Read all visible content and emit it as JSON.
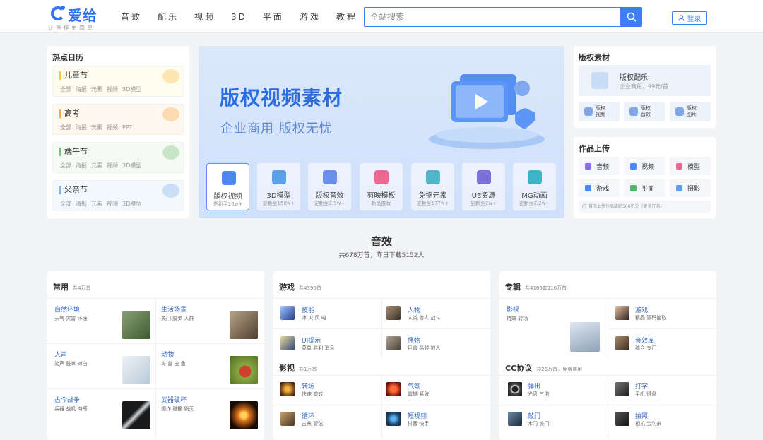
{
  "header": {
    "logo_text": "爱给",
    "slogan": "让创作更简单",
    "nav": [
      "音效",
      "配乐",
      "视频",
      "3D",
      "平面",
      "游戏",
      "教程"
    ],
    "search_placeholder": "全站搜索",
    "login_label": "登录"
  },
  "hot_calendar": {
    "title": "热点日历",
    "items": [
      {
        "name": "儿童节",
        "tags": [
          "全部",
          "海报",
          "元素",
          "视频",
          "3D模型"
        ],
        "deco_color": "#f5c242"
      },
      {
        "name": "高考",
        "tags": [
          "全部",
          "海报",
          "元素",
          "视频",
          "PPT"
        ],
        "deco_color": "#f5a742"
      },
      {
        "name": "端午节",
        "tags": [
          "全部",
          "海报",
          "元素",
          "视频",
          "3D模型"
        ],
        "deco_color": "#6fbf73"
      },
      {
        "name": "父亲节",
        "tags": [
          "全部",
          "海报",
          "元素",
          "视频",
          "3D模型"
        ],
        "deco_color": "#7fb2e8"
      }
    ]
  },
  "banner": {
    "title": "版权视频素材",
    "subtitle": "企业商用 版权无忧",
    "categories": [
      {
        "label": "版权视频",
        "sub": "更新至26w+",
        "color": "#4c86ef"
      },
      {
        "label": "3D模型",
        "sub": "更新至150w+",
        "color": "#5aa0ef"
      },
      {
        "label": "版权音效",
        "sub": "更新至2.9w+",
        "color": "#6a8ff0"
      },
      {
        "label": "剪映模板",
        "sub": "新品推荐",
        "color": "#e86a8f"
      },
      {
        "label": "免抠元素",
        "sub": "更新至177w+",
        "color": "#4fb7c9"
      },
      {
        "label": "UE资源",
        "sub": "更新至2w+",
        "color": "#7a6fe0"
      },
      {
        "label": "MG动画",
        "sub": "更新至2.2w+",
        "color": "#3fb3c7"
      }
    ]
  },
  "copyright_material": {
    "title": "版权素材",
    "main": {
      "name": "版权配乐",
      "sub": "企业商用，99元/首"
    },
    "items": [
      "版权视频",
      "版权音效",
      "版权图片"
    ]
  },
  "upload": {
    "title": "作品上传",
    "items": [
      {
        "label": "音频",
        "color": "#8a6ee8"
      },
      {
        "label": "视频",
        "color": "#4c86ef"
      },
      {
        "label": "模型",
        "color": "#e86a8f"
      },
      {
        "label": "游戏",
        "color": "#4c86ef"
      },
      {
        "label": "平面",
        "color": "#4fb76a"
      },
      {
        "label": "摄影",
        "color": "#5a9ff0"
      }
    ],
    "note": "首次上传作品奖励500积分（更多任务）"
  },
  "section": {
    "title": "音效",
    "subtitle": "共678万首，昨日下载5152人"
  },
  "common": {
    "title": "常用",
    "count": "共4万首",
    "cells": [
      {
        "name": "自然环境",
        "tags": "天气 灾害 环境",
        "thumb": "#5d7a4e"
      },
      {
        "name": "生活场景",
        "tags": "关门 脚步 人群",
        "thumb": "#6b5a48"
      },
      {
        "name": "人声",
        "tags": "笑声 鼓掌 对白",
        "thumb": "#cfdbe6"
      },
      {
        "name": "动物",
        "tags": "鸟 兽 虫 鱼",
        "thumb": "#6e8c36"
      },
      {
        "name": "古今战争",
        "tags": "兵器 战机 肉搏",
        "thumb": "#1c1c1c"
      },
      {
        "name": "武器破坏",
        "tags": "爆炸 碰撞 毁灭",
        "thumb": "#2a1608"
      }
    ]
  },
  "games": {
    "title": "游戏",
    "count": "共4390首",
    "cells": [
      {
        "name": "技能",
        "tags": "冰 火 风 电",
        "thumb": "#3a5bb0"
      },
      {
        "name": "人物",
        "tags": "人类 兽人 战斗",
        "thumb": "#6b5e4a"
      },
      {
        "name": "UI提示",
        "tags": "菜单 胜利 消息",
        "thumb": "#3d5f8c"
      },
      {
        "name": "怪物",
        "tags": "巨兽 骷髅 狼人",
        "thumb": "#7a6e60"
      }
    ]
  },
  "video": {
    "title": "影视",
    "count": "共1万首",
    "cells": [
      {
        "name": "转场",
        "tags": "快速 旋转",
        "thumb": "#7a4a1a"
      },
      {
        "name": "气氛",
        "tags": "震撼 紧张",
        "thumb": "#8a2010"
      },
      {
        "name": "循环",
        "tags": "古典 管弦",
        "thumb": "#6a5038"
      },
      {
        "name": "短视频",
        "tags": "抖音 快手",
        "thumb": "#2a4a6a"
      }
    ]
  },
  "albums": {
    "title": "专辑",
    "count": "共4166套116万首",
    "cells": [
      {
        "name": "影视",
        "tags": "特效 转场",
        "thumb": "#a8b8cc"
      },
      {
        "name": "游戏",
        "tags": "精品 源码抽取",
        "thumb": "#3a3030"
      },
      {
        "name": "音效库",
        "tags": "综合 专门",
        "thumb": "#5a4a3a"
      }
    ]
  },
  "cc": {
    "title": "CC协议",
    "count": "共26万首，免费商用",
    "cells": [
      {
        "name": "弹出",
        "tags": "光盘 气泡",
        "thumb": "#1a1a1a"
      },
      {
        "name": "打字",
        "tags": "手机 键盘",
        "thumb": "#3a3a3a"
      },
      {
        "name": "敲门",
        "tags": "木门 铁门",
        "thumb": "#2a3a4a"
      },
      {
        "name": "拍照",
        "tags": "相机 宝利来",
        "thumb": "#222"
      }
    ]
  }
}
